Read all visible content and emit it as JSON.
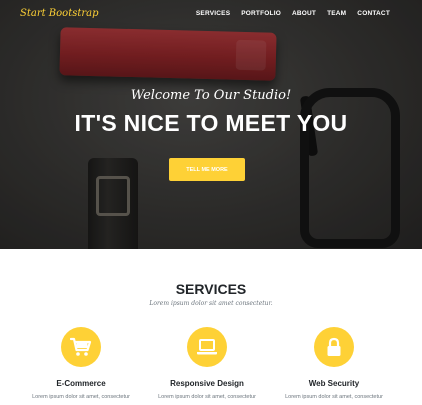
{
  "brand": "Start Bootstrap",
  "nav": [
    "SERVICES",
    "PORTFOLIO",
    "ABOUT",
    "TEAM",
    "CONTACT"
  ],
  "hero": {
    "lead": "Welcome To Our Studio!",
    "heading": "IT'S NICE TO MEET YOU",
    "button": "TELL ME MORE"
  },
  "services": {
    "heading": "SERVICES",
    "subheading": "Lorem ipsum dolor sit amet consectetur.",
    "items": [
      {
        "icon": "shopping-cart-icon",
        "title": "E-Commerce",
        "text": "Lorem ipsum dolor sit amet, consectetur"
      },
      {
        "icon": "laptop-icon",
        "title": "Responsive Design",
        "text": "Lorem ipsum dolor sit amet, consectetur"
      },
      {
        "icon": "lock-icon",
        "title": "Web Security",
        "text": "Lorem ipsum dolor sit amet, consectetur"
      }
    ]
  },
  "colors": {
    "accent": "#fed136",
    "heading": "#212529",
    "muted": "#6c757d"
  }
}
